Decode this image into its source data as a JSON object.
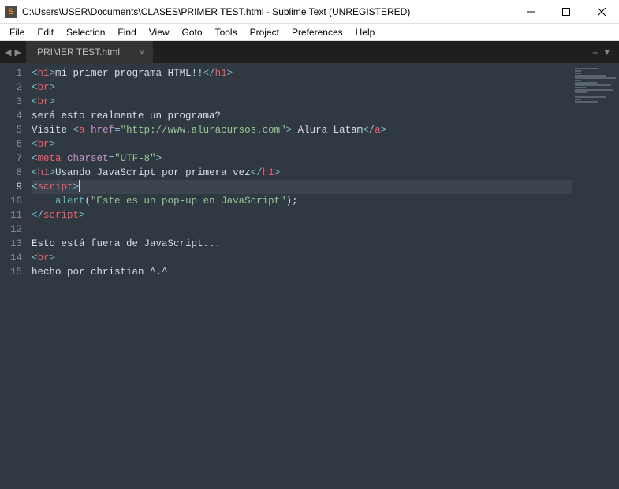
{
  "window": {
    "title": "C:\\Users\\USER\\Documents\\CLASES\\PRIMER TEST.html - Sublime Text (UNREGISTERED)",
    "app_icon_letter": "S"
  },
  "menu": {
    "items": [
      "File",
      "Edit",
      "Selection",
      "Find",
      "View",
      "Goto",
      "Tools",
      "Project",
      "Preferences",
      "Help"
    ]
  },
  "tabs": {
    "nav_left": "◀",
    "nav_right": "▶",
    "active_tab": "PRIMER TEST.html",
    "close_glyph": "×",
    "add_glyph": "+",
    "overflow_glyph": "▾"
  },
  "editor": {
    "line_numbers": [
      "1",
      "2",
      "3",
      "4",
      "5",
      "6",
      "7",
      "8",
      "9",
      "10",
      "11",
      "12",
      "13",
      "14",
      "15"
    ],
    "active_line": 9,
    "lines": [
      {
        "segs": [
          {
            "t": "<",
            "c": "brkt"
          },
          {
            "t": "h1",
            "c": "tag"
          },
          {
            "t": ">",
            "c": "brkt"
          },
          {
            "t": "mi primer programa HTML!!",
            "c": "txt"
          },
          {
            "t": "</",
            "c": "brkt"
          },
          {
            "t": "h1",
            "c": "tag"
          },
          {
            "t": ">",
            "c": "brkt"
          }
        ]
      },
      {
        "segs": [
          {
            "t": "<",
            "c": "brkt"
          },
          {
            "t": "br",
            "c": "tag"
          },
          {
            "t": ">",
            "c": "brkt"
          }
        ]
      },
      {
        "segs": [
          {
            "t": "<",
            "c": "brkt"
          },
          {
            "t": "br",
            "c": "tag"
          },
          {
            "t": ">",
            "c": "brkt"
          }
        ]
      },
      {
        "segs": [
          {
            "t": "será esto realmente un programa?",
            "c": "txt"
          }
        ]
      },
      {
        "segs": [
          {
            "t": "Visite ",
            "c": "txt"
          },
          {
            "t": "<",
            "c": "brkt"
          },
          {
            "t": "a",
            "c": "tag"
          },
          {
            "t": " ",
            "c": "txt"
          },
          {
            "t": "href",
            "c": "attr"
          },
          {
            "t": "=",
            "c": "brkt"
          },
          {
            "t": "\"http://www.aluracursos.com\"",
            "c": "str"
          },
          {
            "t": ">",
            "c": "brkt"
          },
          {
            "t": " Alura Latam",
            "c": "txt"
          },
          {
            "t": "</",
            "c": "brkt"
          },
          {
            "t": "a",
            "c": "tag"
          },
          {
            "t": ">",
            "c": "brkt"
          }
        ]
      },
      {
        "segs": [
          {
            "t": "<",
            "c": "brkt"
          },
          {
            "t": "br",
            "c": "tag"
          },
          {
            "t": ">",
            "c": "brkt"
          }
        ]
      },
      {
        "segs": [
          {
            "t": "<",
            "c": "brkt"
          },
          {
            "t": "meta",
            "c": "tag"
          },
          {
            "t": " ",
            "c": "txt"
          },
          {
            "t": "charset",
            "c": "attr"
          },
          {
            "t": "=",
            "c": "brkt"
          },
          {
            "t": "\"UTF-8\"",
            "c": "str"
          },
          {
            "t": ">",
            "c": "brkt"
          }
        ]
      },
      {
        "segs": [
          {
            "t": "<",
            "c": "brkt"
          },
          {
            "t": "h1",
            "c": "tag"
          },
          {
            "t": ">",
            "c": "brkt"
          },
          {
            "t": "Usando JavaScript por primera vez",
            "c": "txt"
          },
          {
            "t": "</",
            "c": "brkt"
          },
          {
            "t": "h1",
            "c": "tag"
          },
          {
            "t": ">",
            "c": "brkt"
          }
        ]
      },
      {
        "segs": [
          {
            "t": "<",
            "c": "brkt"
          },
          {
            "t": "script",
            "c": "tag"
          },
          {
            "t": ">",
            "c": "brkt"
          }
        ],
        "cursor_after": true
      },
      {
        "segs": [
          {
            "t": "    ",
            "c": "txt"
          },
          {
            "t": "alert",
            "c": "fn"
          },
          {
            "t": "(",
            "c": "txt"
          },
          {
            "t": "\"Este es un pop-up en JavaScript\"",
            "c": "str"
          },
          {
            "t": ");",
            "c": "txt"
          }
        ]
      },
      {
        "segs": [
          {
            "t": "</",
            "c": "brkt"
          },
          {
            "t": "script",
            "c": "tag"
          },
          {
            "t": ">",
            "c": "brkt"
          }
        ]
      },
      {
        "segs": []
      },
      {
        "segs": [
          {
            "t": "Esto está fuera de JavaScript...",
            "c": "txt"
          }
        ]
      },
      {
        "segs": [
          {
            "t": "<",
            "c": "brkt"
          },
          {
            "t": "br",
            "c": "tag"
          },
          {
            "t": ">",
            "c": "brkt"
          }
        ]
      },
      {
        "segs": [
          {
            "t": "hecho por christian ^.^",
            "c": "txt"
          }
        ]
      }
    ]
  }
}
